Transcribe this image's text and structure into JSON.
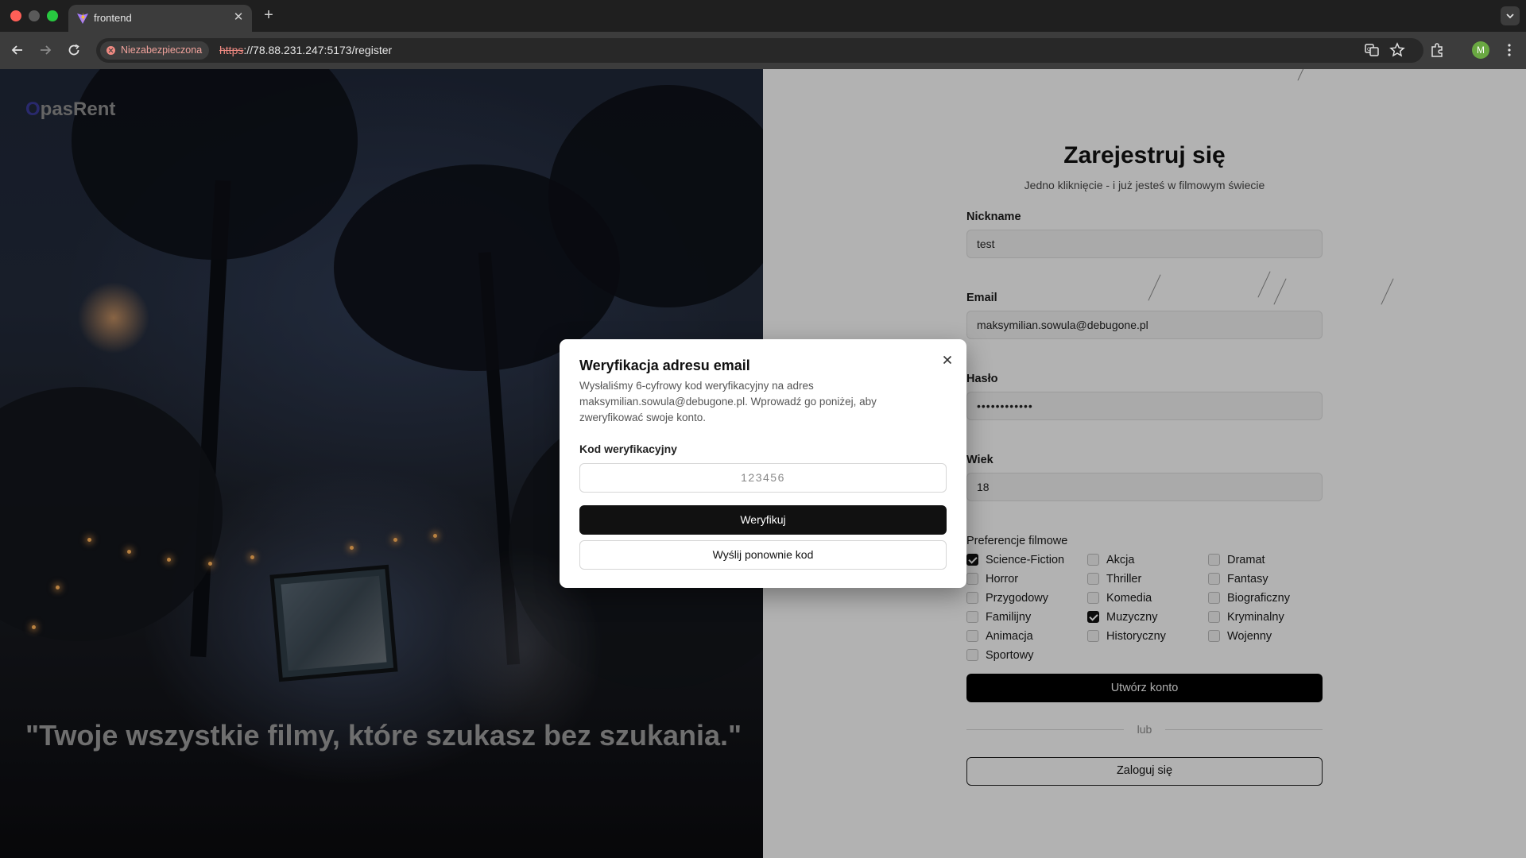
{
  "browser": {
    "tab_title": "frontend",
    "security_label": "Niezabezpieczona",
    "url_scheme": "https",
    "url_rest": "://78.88.231.247:5173/register",
    "profile_initial": "M"
  },
  "hero": {
    "logo_first": "O",
    "logo_rest": "pasRent",
    "quote": "\"Twoje wszystkie filmy, które szukasz bez szukania.\""
  },
  "register": {
    "title": "Zarejestruj się",
    "subtitle": "Jedno kliknięcie - i już jesteś w filmowym świecie",
    "nickname_label": "Nickname",
    "nickname_value": "test",
    "email_label": "Email",
    "email_value": "maksymilian.sowula@debugone.pl",
    "password_label": "Hasło",
    "password_value": "••••••••••••",
    "age_label": "Wiek",
    "age_value": "18",
    "preferences_label": "Preferencje filmowe",
    "genres": [
      {
        "label": "Science-Fiction",
        "checked": true
      },
      {
        "label": "Akcja",
        "checked": false
      },
      {
        "label": "Dramat",
        "checked": false
      },
      {
        "label": "Horror",
        "checked": false
      },
      {
        "label": "Thriller",
        "checked": false
      },
      {
        "label": "Fantasy",
        "checked": false
      },
      {
        "label": "Przygodowy",
        "checked": false
      },
      {
        "label": "Komedia",
        "checked": false
      },
      {
        "label": "Biograficzny",
        "checked": false
      },
      {
        "label": "Familijny",
        "checked": false
      },
      {
        "label": "Muzyczny",
        "checked": true
      },
      {
        "label": "Kryminalny",
        "checked": false
      },
      {
        "label": "Animacja",
        "checked": false
      },
      {
        "label": "Historyczny",
        "checked": false
      },
      {
        "label": "Wojenny",
        "checked": false
      },
      {
        "label": "Sportowy",
        "checked": false
      }
    ],
    "create_button": "Utwórz konto",
    "divider_text": "lub",
    "login_button": "Zaloguj się"
  },
  "modal": {
    "title": "Weryfikacja adresu email",
    "description": "Wysłaliśmy 6-cyfrowy kod weryfikacyjny na adres maksymilian.sowula@debugone.pl. Wprowadź go poniżej, aby zweryfikować swoje konto.",
    "code_label": "Kod weryfikacyjny",
    "code_placeholder": "123456",
    "verify_button": "Weryfikuj",
    "resend_button": "Wyślij ponownie kod"
  },
  "colors": {
    "accent": "#111111",
    "logo_o": "#3a3a98",
    "insecure": "#f08a82"
  }
}
